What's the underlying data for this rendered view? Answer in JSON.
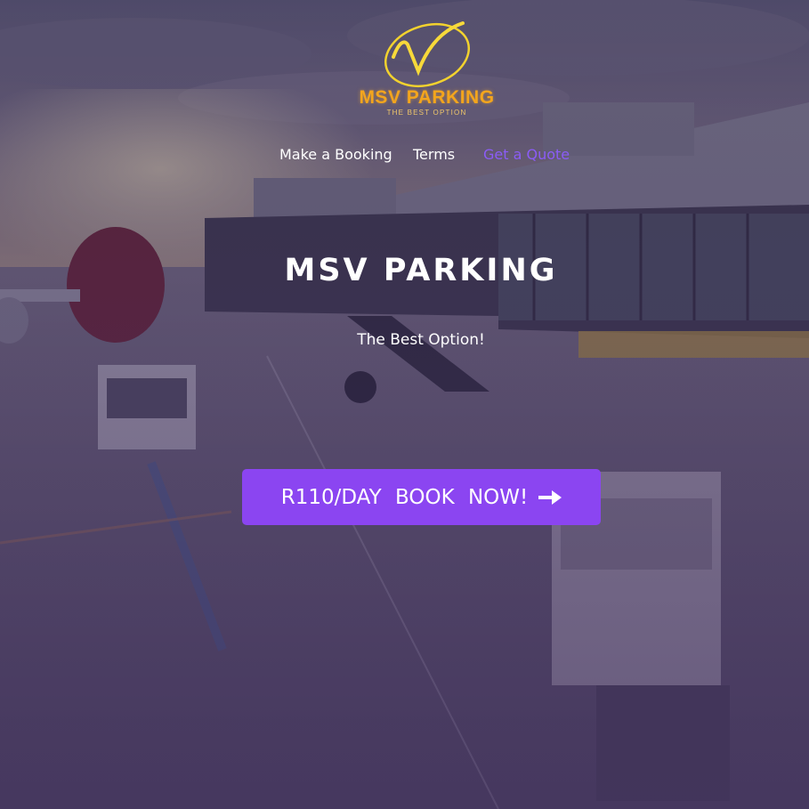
{
  "logo": {
    "name": "MSV PARKING",
    "tagline": "THE BEST OPTION"
  },
  "nav": {
    "items": [
      {
        "label": "Make a Booking"
      },
      {
        "label": "Terms"
      },
      {
        "label": "Get a Quote",
        "active": true
      }
    ]
  },
  "hero": {
    "title": "MSV PARKING",
    "subtitle": "The Best Option!",
    "cta_label": "R110/DAY BOOK NOW!",
    "cta_icon": "arrow-right-icon"
  },
  "colors": {
    "accent": "#8b45f1",
    "active_link": "#8b5cf6",
    "logo_gold": "#f3a51d"
  }
}
